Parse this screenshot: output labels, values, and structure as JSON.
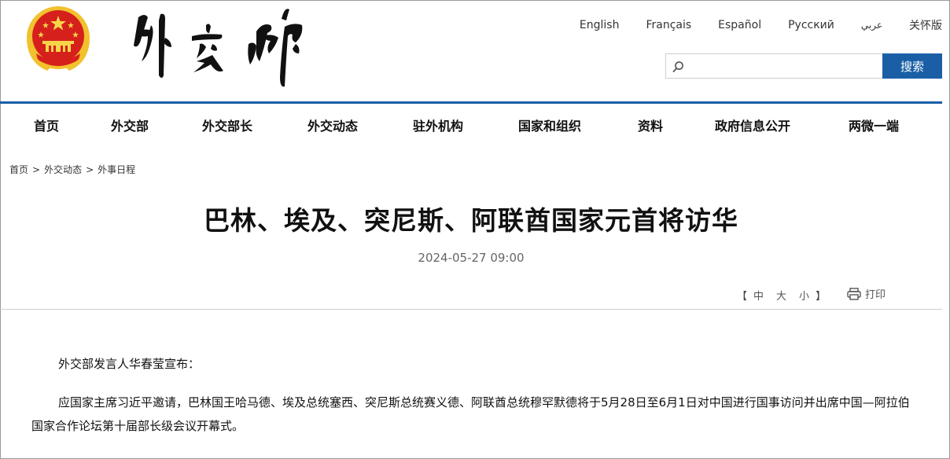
{
  "site": {
    "logo_text": "外交部",
    "emblem": "national-emblem"
  },
  "languages": [
    "English",
    "Français",
    "Español",
    "Русский",
    "عربي",
    "关怀版"
  ],
  "search": {
    "placeholder": "",
    "button_label": "搜索",
    "icon": "search-icon"
  },
  "nav": [
    "首页",
    "外交部",
    "外交部长",
    "外交动态",
    "驻外机构",
    "国家和组织",
    "资料",
    "政府信息公开",
    "两微一端"
  ],
  "breadcrumb": {
    "items": [
      "首页",
      "外交动态",
      "外事日程"
    ],
    "separator": ">"
  },
  "article": {
    "title": "巴林、埃及、突尼斯、阿联酋国家元首将访华",
    "date": "2024-05-27 09:00",
    "font_size": {
      "open": "【",
      "options": [
        "中",
        "大",
        "小"
      ],
      "close": "】"
    },
    "print_label": "打印",
    "paragraphs": [
      "外交部发言人华春莹宣布：",
      "应国家主席习近平邀请，巴林国王哈马德、埃及总统塞西、突尼斯总统赛义德、阿联酋总统穆罕默德将于5月28日至6月1日对中国进行国事访问并出席中国—阿拉伯国家合作论坛第十届部长级会议开幕式。"
    ]
  },
  "colors": {
    "accent": "#1a5fa6",
    "emblem_red": "#d6201b",
    "emblem_gold": "#f2c12e"
  }
}
